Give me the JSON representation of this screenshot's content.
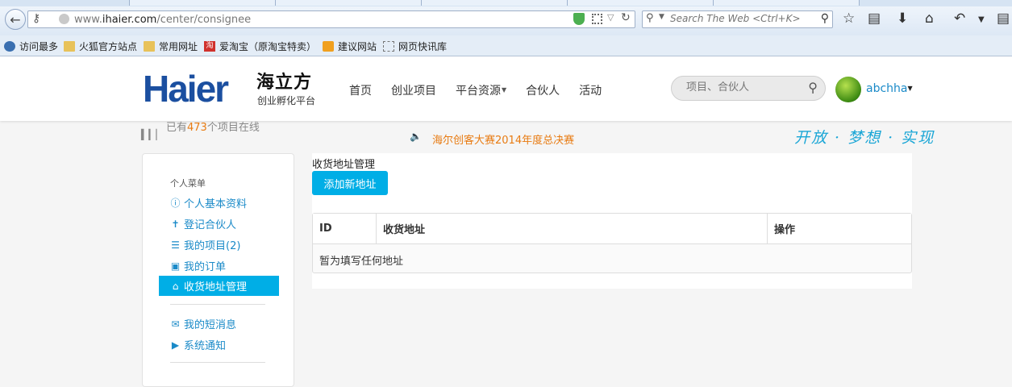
{
  "browser": {
    "url_prefix": "www.",
    "url_domain": "ihaier.com",
    "url_path": "/center/consignee",
    "search_placeholder": "Search The Web <Ctrl+K>",
    "bookmarks": [
      "访问最多",
      "火狐官方站点",
      "常用网址",
      "爱淘宝（原淘宝特卖）",
      "建议网站",
      "网页快讯库"
    ],
    "toolbar_icons": [
      "star-icon",
      "reading-list-icon",
      "download-icon",
      "home-icon",
      "undo-icon",
      "menu-icon"
    ]
  },
  "site": {
    "logo_en": "Haier",
    "logo_cn": "海立方",
    "logo_sub": "创业孵化平台",
    "nav": [
      "首页",
      "创业项目",
      "平台资源",
      "合伙人",
      "活动"
    ],
    "search_placeholder": "项目、合伙人",
    "username": "abchha",
    "brand_color": "#1b4fa0",
    "accent_color": "#00aee6",
    "highlight_color": "#e87b12"
  },
  "info": {
    "stats_prefix": "已有",
    "stats_count": "473",
    "stats_suffix": "个项目在线",
    "announcement": "海尔创客大赛2014年度总决赛",
    "slogan": "开放 · 梦想 · 实现"
  },
  "sidebar": {
    "heading": "个人菜单",
    "items": [
      {
        "label": "个人基本资料",
        "icon": "info-icon"
      },
      {
        "label": "登记合伙人",
        "icon": "user-icon"
      },
      {
        "label": "我的项目(2)",
        "icon": "list-icon"
      },
      {
        "label": "我的订单",
        "icon": "cart-icon"
      },
      {
        "label": "收货地址管理",
        "icon": "home-icon",
        "active": true
      }
    ],
    "items2": [
      {
        "label": "我的短消息",
        "icon": "envelope-icon"
      },
      {
        "label": "系统通知",
        "icon": "megaphone-icon"
      }
    ]
  },
  "main": {
    "title": "收货地址管理",
    "add_button": "添加新地址",
    "table": {
      "headers": [
        "ID",
        "收货地址",
        "操作"
      ],
      "empty_text": "暂为填写任何地址"
    }
  }
}
